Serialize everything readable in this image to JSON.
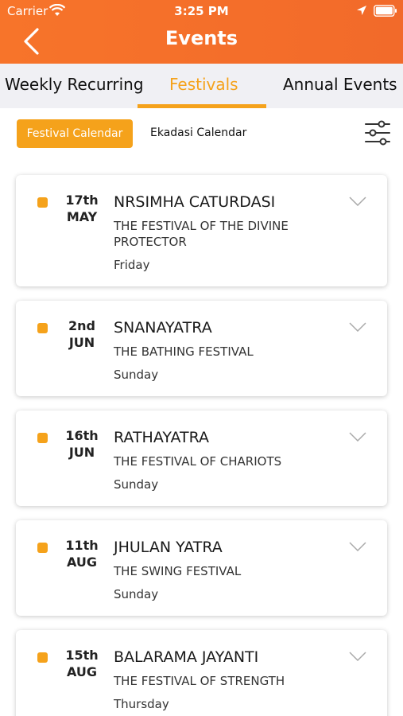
{
  "status": {
    "carrier": "Carrier",
    "time": "3:25 PM"
  },
  "header": {
    "title": "Events"
  },
  "tabs": [
    {
      "label": "Weekly Recurring"
    },
    {
      "label": "Festivals",
      "active": true
    },
    {
      "label": "Annual Events"
    }
  ],
  "subtabs": [
    {
      "label": "Festival Calendar",
      "active": true
    },
    {
      "label": "Ekadasi Calendar"
    }
  ],
  "colors": {
    "header": "#f26a2a",
    "accent": "#f5a21b",
    "tab_bg": "#f0f0f4"
  },
  "events": [
    {
      "day": "17th",
      "month": "MAY",
      "title": "NRSIMHA CATURDASI",
      "subtitle": "THE FESTIVAL OF THE DIVINE PROTECTOR",
      "weekday": "Friday"
    },
    {
      "day": "2nd",
      "month": "JUN",
      "title": "SNANAYATRA",
      "subtitle": "THE BATHING FESTIVAL",
      "weekday": "Sunday"
    },
    {
      "day": "16th",
      "month": "JUN",
      "title": "RATHAYATRA",
      "subtitle": "THE FESTIVAL OF CHARIOTS",
      "weekday": "Sunday"
    },
    {
      "day": "11th",
      "month": "AUG",
      "title": "JHULAN YATRA",
      "subtitle": "THE SWING FESTIVAL",
      "weekday": "Sunday"
    },
    {
      "day": "15th",
      "month": "AUG",
      "title": "BALARAMA JAYANTI",
      "subtitle": "THE FESTIVAL OF STRENGTH",
      "weekday": "Thursday"
    }
  ]
}
